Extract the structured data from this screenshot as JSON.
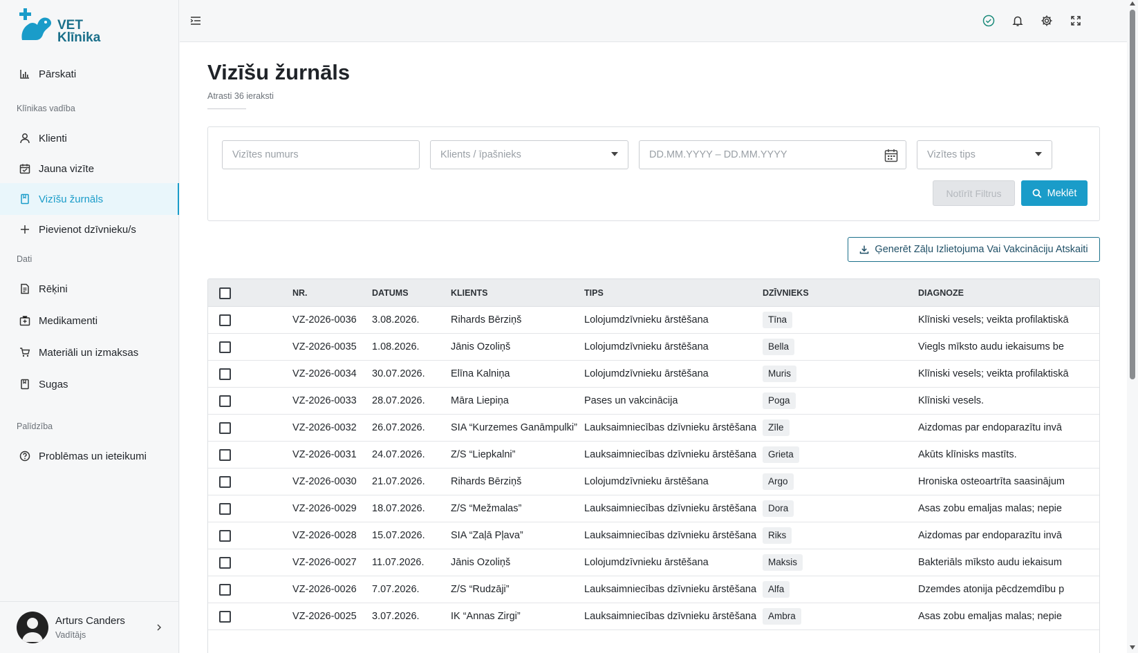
{
  "brand": {
    "line1": "VET",
    "line2": "Klīnika"
  },
  "sidebar": {
    "items": [
      {
        "label": "Pārskati",
        "icon": "bar-chart-icon"
      },
      {
        "label": "Klienti",
        "icon": "user-icon"
      },
      {
        "label": "Jauna vizīte",
        "icon": "calendar-icon"
      },
      {
        "label": "Vizīšu žurnāls",
        "icon": "book-icon"
      },
      {
        "label": "Pievienot dzīvnieku/s",
        "icon": "plus-icon"
      },
      {
        "label": "Rēķini",
        "icon": "document-icon"
      },
      {
        "label": "Medikamenti",
        "icon": "medkit-icon"
      },
      {
        "label": "Materiāli un izmaksas",
        "icon": "cart-icon"
      },
      {
        "label": "Sugas",
        "icon": "book-icon"
      },
      {
        "label": "Problēmas un ieteikumi",
        "icon": "help-icon"
      }
    ],
    "sections": [
      "Klīnikas vadība",
      "Dati",
      "Palīdzība"
    ],
    "active_index": 3
  },
  "user": {
    "name": "Arturs Canders",
    "role": "Vadītājs"
  },
  "topbar": {
    "icons": [
      "menu-icon",
      "check-circle-icon",
      "bell-icon",
      "gear-icon",
      "fullscreen-icon"
    ]
  },
  "page": {
    "title": "Vizīšu žurnāls",
    "subtitle": "Atrasti 36 ieraksti"
  },
  "filters": {
    "visit_number_placeholder": "Vizītes numurs",
    "client_placeholder": "Klients / īpašnieks",
    "date_placeholder": "DD.MM.YYYY – DD.MM.YYYY",
    "type_placeholder": "Vizītes tips",
    "clear_label": "Notīrīt Filtrus",
    "search_label": "Meklēt"
  },
  "report_button": "Ģenerēt Zāļu Izlietojuma Vai Vakcināciju Atskaiti",
  "table": {
    "headers": [
      "NR.",
      "DATUMS",
      "KLIENTS",
      "TIPS",
      "DZĪVNIEKS",
      "DIAGNOZE"
    ],
    "rows": [
      {
        "nr": "VZ-2026-0036",
        "date": "3.08.2026.",
        "client": "Rihards Bērziņš",
        "type": "Lolojumdzīvnieku ārstēšana",
        "animal": "Tīna",
        "diagnosis": "Klīniski vesels; veikta profilaktiskā"
      },
      {
        "nr": "VZ-2026-0035",
        "date": "1.08.2026.",
        "client": "Jānis Ozoliņš",
        "type": "Lolojumdzīvnieku ārstēšana",
        "animal": "Bella",
        "diagnosis": "Viegls mīksto audu iekaisums be"
      },
      {
        "nr": "VZ-2026-0034",
        "date": "30.07.2026.",
        "client": "Elīna Kalniņa",
        "type": "Lolojumdzīvnieku ārstēšana",
        "animal": "Muris",
        "diagnosis": "Klīniski vesels; veikta profilaktiskā"
      },
      {
        "nr": "VZ-2026-0033",
        "date": "28.07.2026.",
        "client": "Māra Liepiņa",
        "type": "Pases un vakcinācija",
        "animal": "Poga",
        "diagnosis": "Klīniski vesels."
      },
      {
        "nr": "VZ-2026-0032",
        "date": "26.07.2026.",
        "client": "SIA “Kurzemes Ganāmpulki”",
        "type": "Lauksaimniecības dzīvnieku ārstēšana",
        "animal": "Zīle",
        "diagnosis": "Aizdomas par endoparazītu invā"
      },
      {
        "nr": "VZ-2026-0031",
        "date": "24.07.2026.",
        "client": "Z/S “Liepkalni”",
        "type": "Lauksaimniecības dzīvnieku ārstēšana",
        "animal": "Grieta",
        "diagnosis": "Akūts klīnisks mastīts."
      },
      {
        "nr": "VZ-2026-0030",
        "date": "21.07.2026.",
        "client": "Rihards Bērziņš",
        "type": "Lolojumdzīvnieku ārstēšana",
        "animal": "Argo",
        "diagnosis": "Hroniska osteoartrīta saasinājum"
      },
      {
        "nr": "VZ-2026-0029",
        "date": "18.07.2026.",
        "client": "Z/S “Mežmalas”",
        "type": "Lauksaimniecības dzīvnieku ārstēšana",
        "animal": "Dora",
        "diagnosis": "Asas zobu emaljas malas; nepie"
      },
      {
        "nr": "VZ-2026-0028",
        "date": "15.07.2026.",
        "client": "SIA “Zaļā Pļava”",
        "type": "Lauksaimniecības dzīvnieku ārstēšana",
        "animal": "Riks",
        "diagnosis": "Aizdomas par endoparazītu invā"
      },
      {
        "nr": "VZ-2026-0027",
        "date": "11.07.2026.",
        "client": "Jānis Ozoliņš",
        "type": "Lolojumdzīvnieku ārstēšana",
        "animal": "Maksis",
        "diagnosis": "Bakteriāls mīksto audu iekaisum"
      },
      {
        "nr": "VZ-2026-0026",
        "date": "7.07.2026.",
        "client": "Z/S “Rudzāji”",
        "type": "Lauksaimniecības dzīvnieku ārstēšana",
        "animal": "Alfa",
        "diagnosis": "Dzemdes atonija pēcdzemdību p"
      },
      {
        "nr": "VZ-2026-0025",
        "date": "3.07.2026.",
        "client": "IK “Annas Zirgi”",
        "type": "Lauksaimniecības dzīvnieku ārstēšana",
        "animal": "Ambra",
        "diagnosis": "Asas zobu emaljas malas; nepie"
      }
    ]
  },
  "colors": {
    "accent": "#1a9cc9",
    "brand": "#1a6f8a",
    "active_bg": "#e9f6fb"
  }
}
